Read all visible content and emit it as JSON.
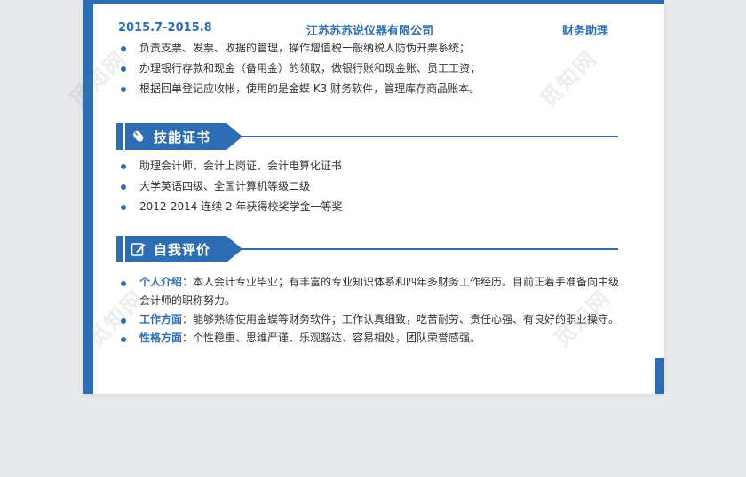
{
  "job": {
    "date": "2015.7-2015.8",
    "company": "江苏苏苏说仪器有限公司",
    "role": "财务助理",
    "duties": [
      "负责支票、发票、收据的管理，操作增值税一般纳税人防伪开票系统；",
      "办理银行存款和现金（备用金）的领取，做银行账和现金账、员工工资；",
      "根据回单登记应收帐，使用的是金蝶 K3 财务软件，管理库存商品账本。"
    ]
  },
  "skills": {
    "title": "技能证书",
    "icon": "mouse-icon",
    "items": [
      "助理会计师、会计上岗证、会计电算化证书",
      "大学英语四级、全国计算机等级二级",
      "2012-2014 连续 2 年获得校奖学金一等奖"
    ]
  },
  "evaluation": {
    "title": "自我评价",
    "icon": "edit-icon",
    "items": [
      {
        "label": "个人介绍",
        "sep": "：",
        "text": "本人会计专业毕业；有丰富的专业知识体系和四年多财务工作经历。目前正着手准备向中级会计师的职称努力。"
      },
      {
        "label": "工作方面",
        "sep": "：",
        "text": "能够熟练使用金蝶等财务软件；工作认真细致，吃苦耐劳、责任心强、有良好的职业操守。"
      },
      {
        "label": "性格方面",
        "sep": "：",
        "text": "个性稳重、思维严谨、乐观豁达、容易相处，团队荣誉感强。"
      }
    ]
  },
  "watermark": "觅知网",
  "colors": {
    "accent": "#2d6db4",
    "text": "#333333",
    "background": "#e8e9eb",
    "page": "#ffffff"
  }
}
